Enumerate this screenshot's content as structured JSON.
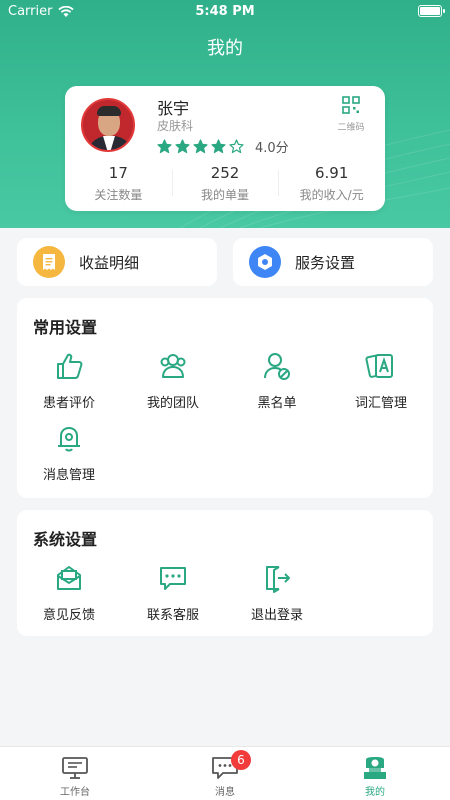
{
  "status_bar": {
    "carrier": "Carrier",
    "time": "5:48 PM"
  },
  "page_title": "我的",
  "profile": {
    "name": "张宇",
    "department": "皮肤科",
    "rating_stars": 4,
    "rating_max": 5,
    "score": "4.0分",
    "qr_label": "二维码",
    "stats": [
      {
        "value": "17",
        "label": "关注数量"
      },
      {
        "value": "252",
        "label": "我的单量"
      },
      {
        "value": "6.91",
        "label": "我的收入/元"
      }
    ]
  },
  "quick_actions": [
    {
      "label": "收益明细",
      "icon": "receipt-icon",
      "color": "#f5b740"
    },
    {
      "label": "服务设置",
      "icon": "hexagon-settings-icon",
      "color": "#3e86f5"
    }
  ],
  "common_settings": {
    "title": "常用设置",
    "items": [
      {
        "label": "患者评价",
        "icon": "thumbs-up-icon"
      },
      {
        "label": "我的团队",
        "icon": "team-icon"
      },
      {
        "label": "黑名单",
        "icon": "blocked-user-icon"
      },
      {
        "label": "词汇管理",
        "icon": "vocabulary-cards-icon"
      },
      {
        "label": "消息管理",
        "icon": "bell-gear-icon"
      }
    ]
  },
  "system_settings": {
    "title": "系统设置",
    "items": [
      {
        "label": "意见反馈",
        "icon": "feedback-envelope-icon"
      },
      {
        "label": "联系客服",
        "icon": "chat-support-icon"
      },
      {
        "label": "退出登录",
        "icon": "logout-icon"
      }
    ]
  },
  "tabbar": {
    "tabs": [
      {
        "label": "工作台",
        "icon": "monitor-icon",
        "active": false
      },
      {
        "label": "消息",
        "icon": "message-icon",
        "active": false
      },
      {
        "label": "我的",
        "icon": "profile-icon",
        "active": true
      }
    ],
    "message_badge": "6"
  },
  "colors": {
    "accent": "#2aa882",
    "header": "#35b78f",
    "badge": "#f23b3b"
  }
}
